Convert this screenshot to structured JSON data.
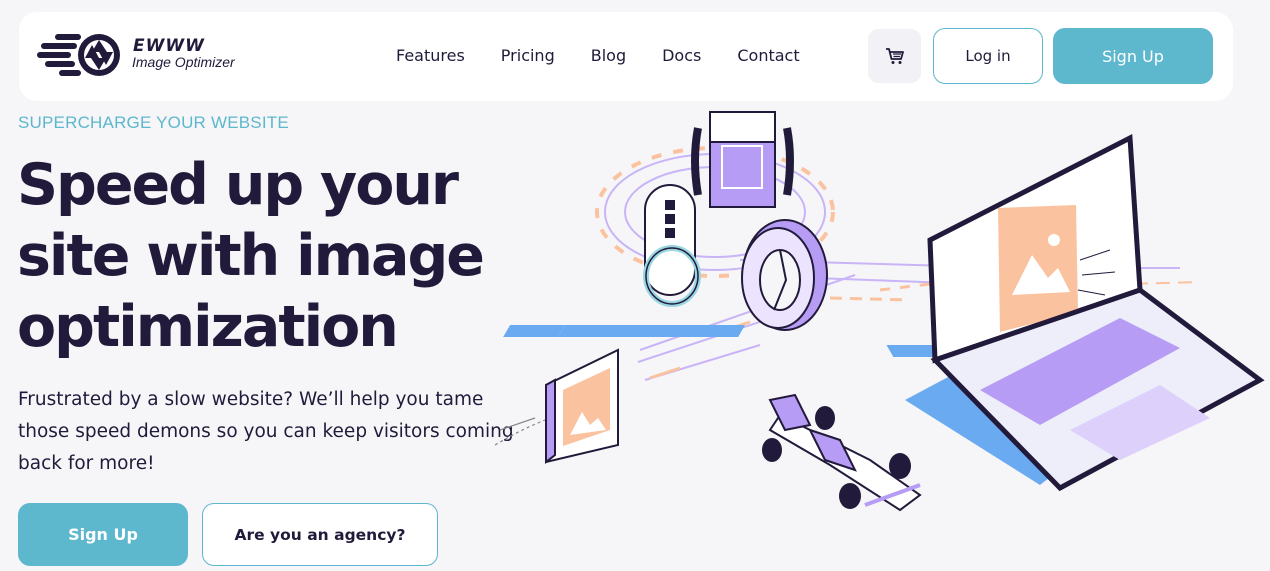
{
  "header": {
    "logo": {
      "name": "EWWW",
      "subtitle": "Image Optimizer",
      "icon": "camera-shutter-logo-icon"
    },
    "nav": [
      {
        "label": "Features"
      },
      {
        "label": "Pricing"
      },
      {
        "label": "Blog"
      },
      {
        "label": "Docs"
      },
      {
        "label": "Contact"
      }
    ],
    "cart_icon": "shopping-cart-icon",
    "login_label": "Log in",
    "signup_label": "Sign Up"
  },
  "hero": {
    "eyebrow": "SUPERCHARGE YOUR WEBSITE",
    "headline": "Speed up your site with image optimization",
    "subtext": "Frustrated by a slow website? We’ll help you tame those speed demons so you can keep visitors coming back for more!",
    "primary_cta": "Sign Up",
    "secondary_cta": "Are you an agency?"
  },
  "colors": {
    "accent": "#5db7cd",
    "text_dark": "#221a3a",
    "purple": "#b79cf5",
    "peach": "#fbc29f",
    "blue": "#6aaaf0",
    "background": "#f6f6f9"
  }
}
